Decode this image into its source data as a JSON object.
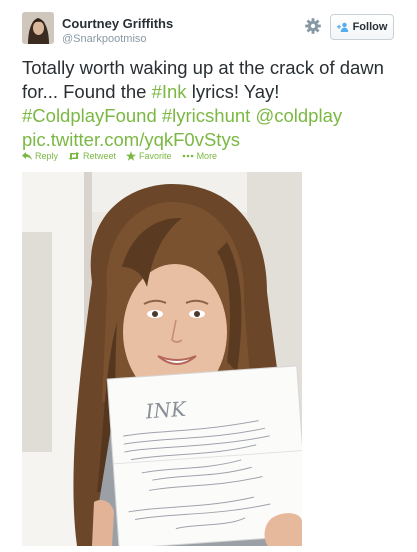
{
  "tweet": {
    "author": {
      "display_name": "Courtney Griffiths",
      "handle": "@Snarkpootmiso"
    },
    "follow_label": "Follow",
    "text": {
      "part1": "Totally worth waking up at the crack of dawn for... Found the ",
      "hashtag_ink": "#Ink",
      "part2": " lyrics! Yay! ",
      "hashtag_found": "#ColdplayFound",
      "space1": " ",
      "hashtag_hunt": "#lyricshunt",
      "space2": " ",
      "mention": "@coldplay",
      "space3": " ",
      "pic_link": "pic.twitter.com/yqkF0vStys"
    },
    "actions": {
      "reply": "Reply",
      "retweet": "Retweet",
      "favorite": "Favorite",
      "more": "More"
    }
  },
  "icons": {
    "settings": "gear-icon",
    "follow": "add-user-icon",
    "reply": "reply-icon",
    "retweet": "retweet-icon",
    "favorite": "star-icon",
    "more": "more-dots-icon"
  },
  "colors": {
    "link": "#7bb843",
    "text": "#292f33",
    "muted": "#8899a6"
  },
  "photo": {
    "paper_heading": "INK"
  }
}
